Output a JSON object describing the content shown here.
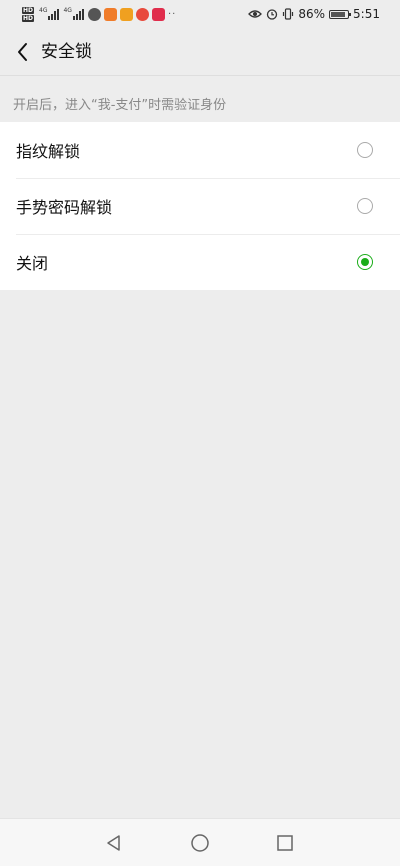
{
  "status_bar": {
    "battery_percent": "86%",
    "time": "5:51",
    "network_tag_1": "4G",
    "network_tag_2": "4G",
    "hd_label": "HD",
    "battery_level": 0.86,
    "app_icon_colors": [
      "#555555",
      "#f07c2a",
      "#f0a020",
      "#e84a3c",
      "#e02d4c"
    ]
  },
  "nav": {
    "back_icon": "chevron-left-icon",
    "title": "安全锁"
  },
  "hint": "开启后，进入“我-支付”时需验证身份",
  "options": [
    {
      "label": "指纹解锁",
      "selected": false
    },
    {
      "label": "手势密码解锁",
      "selected": false
    },
    {
      "label": "关闭",
      "selected": true
    }
  ],
  "colors": {
    "accent": "#1aad19",
    "background": "#ededed"
  }
}
